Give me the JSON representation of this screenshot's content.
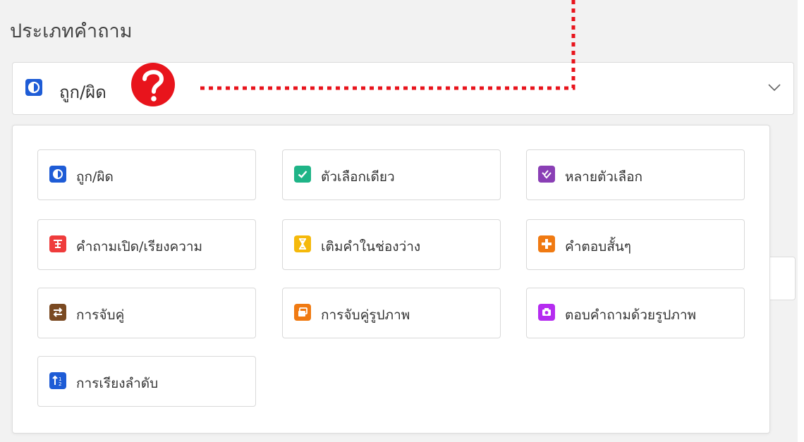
{
  "field_label": "ประเภทคำถาม",
  "selected": {
    "label": "ถูก/ผิด",
    "icon": "true-false-icon",
    "color": "#1e5cd6"
  },
  "annotation": {
    "icon": "question-mark-icon",
    "color": "#e8141c"
  },
  "options": [
    {
      "label": "ถูก/ผิด",
      "icon": "true-false-icon",
      "color": "#1e5cd6"
    },
    {
      "label": "ตัวเลือกเดียว",
      "icon": "check-icon",
      "color": "#1fb487"
    },
    {
      "label": "หลายตัวเลือก",
      "icon": "multi-check-icon",
      "color": "#8a3fb5"
    },
    {
      "label": "คำถามเปิด/เรียงความ",
      "icon": "essay-icon",
      "color": "#ef3c3c"
    },
    {
      "label": "เติมคำในช่องว่าง",
      "icon": "hourglass-icon",
      "color": "#f5b90b"
    },
    {
      "label": "คำตอบสั้นๆ",
      "icon": "short-answer-icon",
      "color": "#f07a12"
    },
    {
      "label": "การจับคู่",
      "icon": "swap-icon",
      "color": "#7a4a22"
    },
    {
      "label": "การจับคู่รูปภาพ",
      "icon": "image-match-icon",
      "color": "#f07a12"
    },
    {
      "label": "ตอบคำถามด้วยรูปภาพ",
      "icon": "camera-icon",
      "color": "#b52cf0"
    },
    {
      "label": "การเรียงลำดับ",
      "icon": "sort-icon",
      "color": "#1e5cd6"
    }
  ]
}
